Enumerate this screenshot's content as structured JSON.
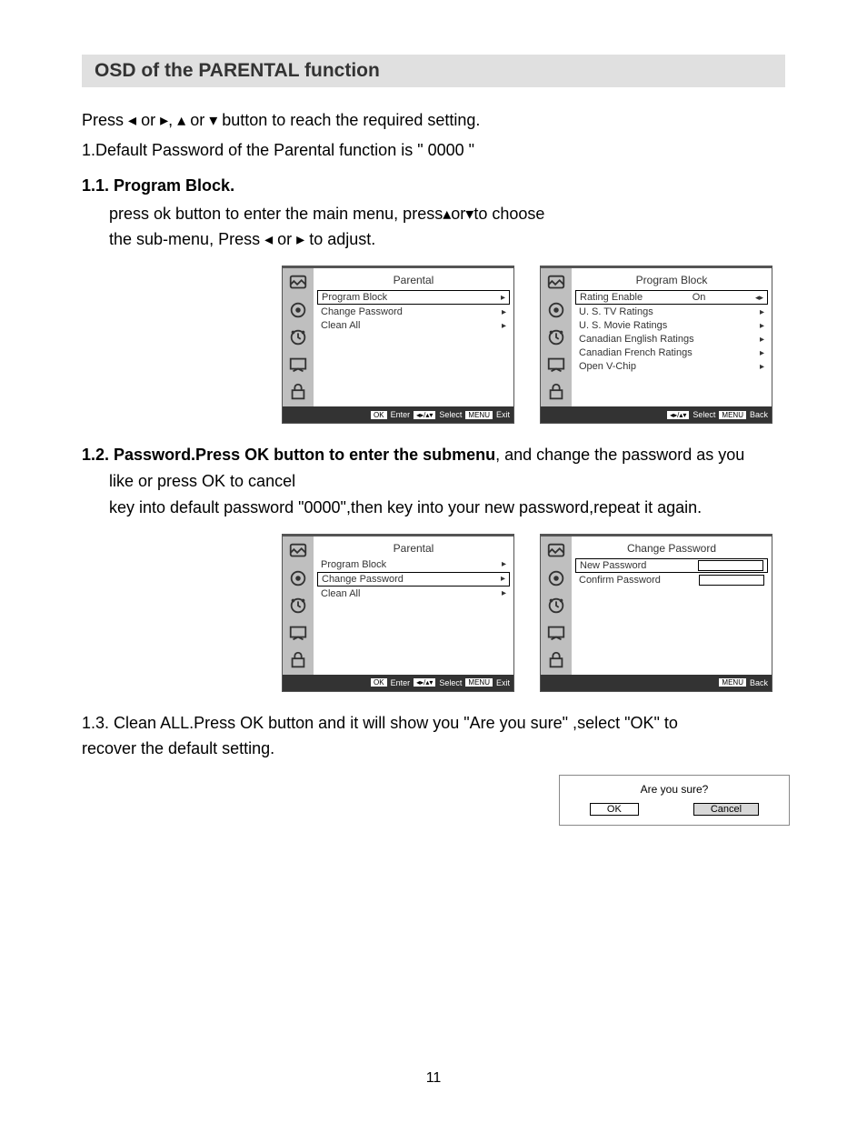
{
  "title": "OSD of the PARENTAL function",
  "intro1_a": "Press ",
  "intro1_b": " or ",
  "intro1_c": ", ",
  "intro1_d": " or ",
  "intro1_e": " button to reach the required setting.",
  "intro2": "1.Default Password of the Parental function is \" 0000 \"",
  "s11_head": "1.1. Program Block.",
  "s11_p1_a": "press ok button to enter the main menu, press",
  "s11_p1_b": "or",
  "s11_p1_c": "to choose",
  "s11_p2_a": "the sub-menu, Press ",
  "s11_p2_b": " or ",
  "s11_p2_c": " to adjust.",
  "osd1": {
    "title": "Parental",
    "items": [
      "Program Block",
      "Change Password",
      "Clean All"
    ],
    "footer_enter": "Enter",
    "footer_select": "Select",
    "footer_exit": "Exit"
  },
  "osd2": {
    "title": "Program Block",
    "item0_label": "Rating Enable",
    "item0_value": "On",
    "items": [
      "U. S. TV Ratings",
      "U. S. Movie Ratings",
      "Canadian English Ratings",
      "Canadian French Ratings",
      "Open V-Chip"
    ],
    "footer_select": "Select",
    "footer_back": "Back"
  },
  "s12_head_a": "1.2. Password.Press OK button to enter the submenu",
  "s12_head_b": ", and change the password as you",
  "s12_line2": "like or press OK to cancel",
  "s12_line3": "key into default password \"0000\",then key into your new password,repeat it again.",
  "osd3": {
    "title": "Parental",
    "items": [
      "Program Block",
      "Change Password",
      "Clean All"
    ],
    "footer_enter": "Enter",
    "footer_select": "Select",
    "footer_exit": "Exit"
  },
  "osd4": {
    "title": "Change Password",
    "row1": "New Password",
    "row2": "Confirm Password",
    "footer_back": "Back"
  },
  "s13_a": "1.3. Clean ALL.Press OK button and it will show you  \"Are you sure\" ,select \"OK\" to",
  "s13_b": "recover the default setting.",
  "dialog": {
    "q": "Are you sure?",
    "ok": "OK",
    "cancel": "Cancel"
  },
  "page_num": "11",
  "keys": {
    "ok": "OK",
    "arrows": "◂▸/▴▾",
    "menu": "MENU"
  }
}
